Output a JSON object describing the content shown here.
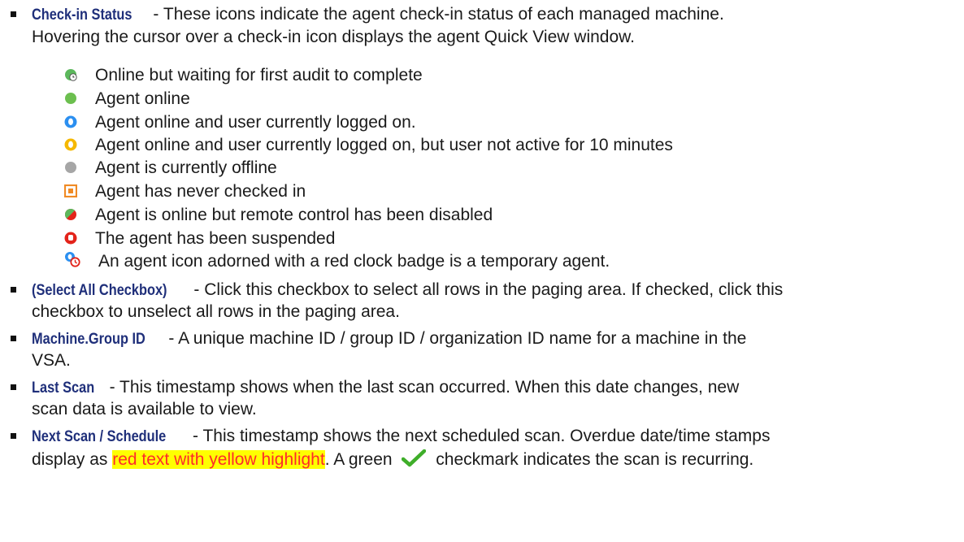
{
  "sections": [
    {
      "term": "Check-in Status",
      "text1": " - These icons indicate the agent check-in status of each managed machine.",
      "text2": "Hovering the cursor over a check-in icon displays the agent Quick View window.",
      "statuses": [
        {
          "icon": "green-clock-circle-icon",
          "label": "Online but waiting for first audit to complete"
        },
        {
          "icon": "green-circle-icon",
          "label": "Agent online"
        },
        {
          "icon": "blue-user-circle-icon",
          "label": "Agent online and user currently logged on."
        },
        {
          "icon": "yellow-user-circle-icon",
          "label": "Agent online and user currently logged on, but user not active for 10 minutes"
        },
        {
          "icon": "gray-circle-icon",
          "label": "Agent is currently offline"
        },
        {
          "icon": "orange-square-icon",
          "label": "Agent has never checked in"
        },
        {
          "icon": "green-red-split-circle-icon",
          "label": "Agent is online but remote control has been disabled"
        },
        {
          "icon": "red-hand-circle-icon",
          "label": "The agent has been suspended"
        },
        {
          "icon": "temporary-agent-clock-badge-icon",
          "label": "An agent icon adorned with a red clock badge is a temporary agent."
        }
      ]
    },
    {
      "term": "(Select All Checkbox)",
      "text1": " - Click this checkbox to select all rows in the paging area. If checked, click this",
      "text2": "checkbox to unselect all rows in the paging area."
    },
    {
      "term": "Machine.Group ID",
      "text1": " - A unique machine ID / group ID / organization ID name for a machine in the",
      "text2": "VSA."
    },
    {
      "term": "Last Scan",
      "text1": " - This timestamp shows when the last scan occurred. When this date changes, new",
      "text2": "scan data is available to view."
    },
    {
      "term": "Next Scan / Schedule",
      "text1": " - This timestamp shows the next scheduled scan. Overdue date/time stamps",
      "text2_pre": "display as ",
      "text2_highlight": "red text with yellow highlight",
      "text2_mid": ". A green ",
      "text2_post": " checkmark indicates the scan is recurring.",
      "check_icon": "green-checkmark-icon"
    }
  ],
  "colors": {
    "term": "#1f2f7a",
    "highlight_bg": "#ffff00",
    "highlight_text": "#ff2a2a"
  }
}
